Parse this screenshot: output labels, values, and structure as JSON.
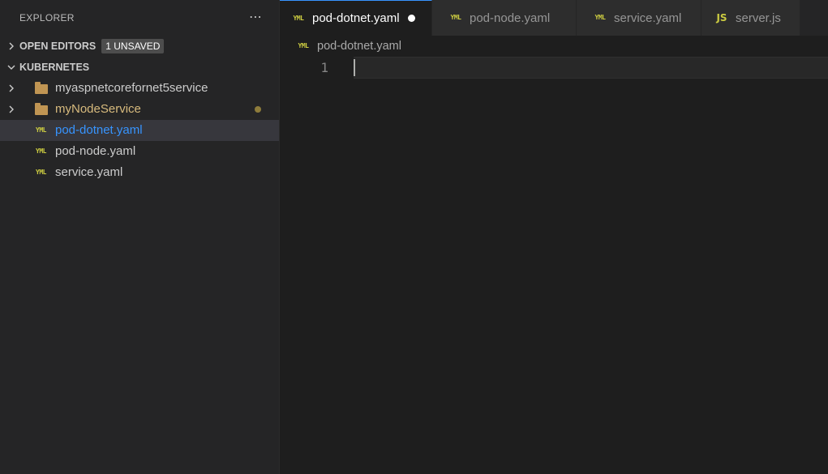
{
  "sidebar": {
    "title": "EXPLORER",
    "more_icon": "ellipsis-icon",
    "open_editors": {
      "label": "OPEN EDITORS",
      "badge": "1 UNSAVED"
    },
    "workspace": {
      "label": "KUBERNETES"
    },
    "items": [
      {
        "label": "myaspnetcorefornet5service",
        "type": "folder",
        "icon": "folder-icon",
        "color": "#cccccc"
      },
      {
        "label": "myNodeService",
        "type": "folder",
        "icon": "folder-icon",
        "color": "#d7ba7d",
        "modified_color": "#8e7c3b"
      },
      {
        "label": "pod-dotnet.yaml",
        "type": "file",
        "icon": "yaml-file-icon",
        "color": "#3794ff",
        "selected": true
      },
      {
        "label": "pod-node.yaml",
        "type": "file",
        "icon": "yaml-file-icon",
        "color": "#cccccc"
      },
      {
        "label": "service.yaml",
        "type": "file",
        "icon": "yaml-file-icon",
        "color": "#cccccc"
      }
    ]
  },
  "tabs": [
    {
      "label": "pod-dotnet.yaml",
      "icon": "yaml-file-icon",
      "active": true,
      "dirty": true
    },
    {
      "label": "pod-node.yaml",
      "icon": "yaml-file-icon",
      "active": false
    },
    {
      "label": "service.yaml",
      "icon": "yaml-file-icon",
      "active": false
    },
    {
      "label": "server.js",
      "icon": "javascript-file-icon",
      "active": false
    }
  ],
  "icon_glyphs": {
    "yaml": "YML",
    "js": "JS"
  },
  "breadcrumb": {
    "file": "pod-dotnet.yaml",
    "icon": "yaml-file-icon"
  },
  "editor": {
    "line_numbers": [
      "1"
    ]
  },
  "colors": {
    "accent": "#3794ff",
    "yaml_icon": "#cbcb41",
    "js_icon": "#cbcb41",
    "folder": "#c09553"
  }
}
